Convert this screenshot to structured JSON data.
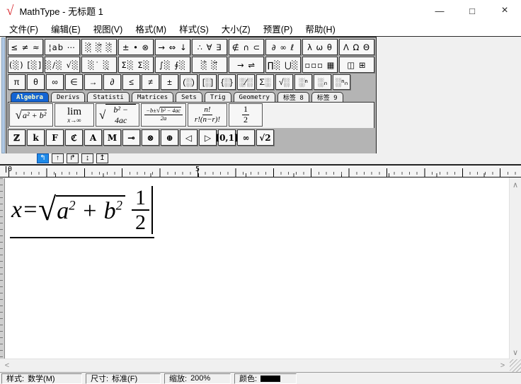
{
  "window": {
    "title": "MathType - 无标题 1",
    "logo_glyph": "√",
    "minimize": "—",
    "maximize": "□",
    "close": "×"
  },
  "menus": [
    "文件(F)",
    "编辑(E)",
    "视图(V)",
    "格式(M)",
    "样式(S)",
    "大小(Z)",
    "预置(P)",
    "帮助(H)"
  ],
  "toolbar": {
    "row1": [
      "≤ ≠ ≈",
      "¦ab ⋯",
      "░́ ░⃗ ░̈",
      "± • ⊗",
      "→ ⇔ ↓",
      "∴ ∀ ∃",
      "∉ ∩ ⊂",
      "∂ ∞ ℓ",
      "λ ω θ",
      "Λ Ω Θ"
    ],
    "row2": [
      "(░) [░]",
      "░∕░ √░",
      "░˙ ░̣",
      "Σ░ Σ░",
      "∫░ ∮░",
      "░̄ ░⃗",
      "→ ⇌",
      "∏░ ⋃░",
      "▫▫▫ ▦",
      "◫ ⊞"
    ],
    "row3": [
      "π",
      "θ",
      "∞",
      "∈",
      "→",
      "∂",
      "≤",
      "≠",
      "±",
      "(░)",
      "[░]",
      "{░}",
      "░∕░",
      "Σ░",
      "√░",
      "░ⁿ",
      "░ₙ",
      "░ⁿₙ"
    ],
    "tabs": [
      {
        "label": "Algebra",
        "selected": true
      },
      {
        "label": "Derivs"
      },
      {
        "label": "Statisti"
      },
      {
        "label": "Matrices"
      },
      {
        "label": "Sets"
      },
      {
        "label": "Trig"
      },
      {
        "label": "Geometry"
      },
      {
        "label": "标签 8"
      },
      {
        "label": "标签 9"
      }
    ],
    "big": [
      {
        "radicand": "a² + b²"
      },
      {
        "top": "lim",
        "bottom": "x→∞"
      },
      {
        "radicand": "b² − 4ac"
      },
      {
        "num_prefix": "−b±",
        "num_radicand": "b² − 4ac",
        "den": "2a"
      },
      {
        "num": "n!",
        "den": "r!(n−r)!"
      },
      {
        "num": "1",
        "den": "2"
      }
    ],
    "symbols": [
      "ℤ",
      "k",
      "F",
      "ℭ",
      "A",
      "M",
      "⊸",
      "⊗",
      "⊕",
      "◁",
      "▷",
      "[0,1]",
      "∞",
      "√2"
    ],
    "tabstops": [
      {
        "glyph": "↰",
        "selected": true
      },
      {
        "glyph": "↑"
      },
      {
        "glyph": "↱"
      },
      {
        "glyph": "↨"
      },
      {
        "glyph": "↥"
      }
    ]
  },
  "ruler": {
    "labels": [
      "0",
      "5"
    ]
  },
  "equation": {
    "prefix": "x=",
    "radical_sign": "√",
    "term1": "a",
    "exp1": "2",
    "op": " + ",
    "term2": "b",
    "exp2": "2",
    "frac_num": "1",
    "frac_den": "2"
  },
  "scroll": {
    "up": "∧",
    "down": "∨",
    "left": "<",
    "right": ">"
  },
  "status": {
    "style_label": "样式:",
    "style_value": "数学(M)",
    "size_label": "尺寸:",
    "size_value": "标准(F)",
    "zoom_label": "缩放:",
    "zoom_value": "200%",
    "color_label": "颜色:",
    "color_value": "#000000"
  },
  "colors": {
    "selected_tab_bg": "#1464d2",
    "selected_tab_text": "#ffffcc",
    "logo_red": "#d9262c",
    "grip_blue": "#b0c8e4",
    "tabstop_selected_bg": "#1e8ae8",
    "color_swatch": "#000000"
  }
}
